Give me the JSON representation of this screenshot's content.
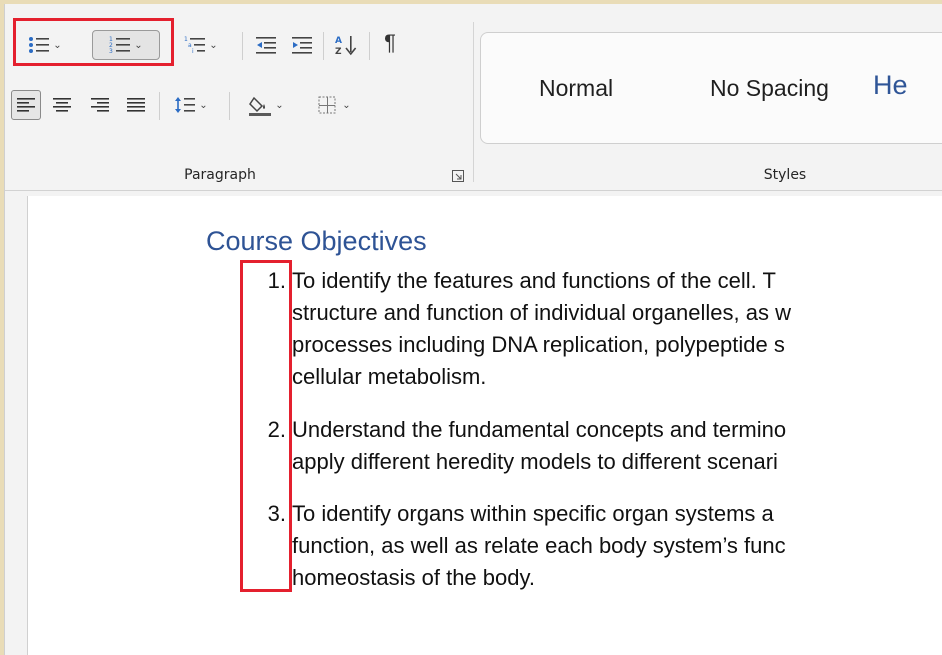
{
  "ribbon": {
    "paragraph_group": {
      "label": "Paragraph",
      "tools": {
        "bullets": "bullet-list-icon",
        "numbering": "numbered-list-icon",
        "multilevel": "multilevel-list-icon",
        "decrease_indent": "decrease-indent-icon",
        "increase_indent": "increase-indent-icon",
        "sort": "sort-icon",
        "show_marks": "¶",
        "align_left": "align-left-icon",
        "center": "align-center-icon",
        "align_right": "align-right-icon",
        "justify": "justify-icon",
        "line_spacing": "line-spacing-icon",
        "shading": "shading-icon",
        "borders": "borders-icon"
      }
    },
    "styles_group": {
      "label": "Styles",
      "items": [
        "Normal",
        "No Spacing",
        "He"
      ]
    }
  },
  "document": {
    "heading": "Course Objectives",
    "list": [
      {
        "number": "1.",
        "lines": [
          "To identify the features and functions of the cell. T",
          "structure and function of individual organelles, as w",
          "processes including DNA replication, polypeptide s",
          "cellular metabolism."
        ]
      },
      {
        "number": "2.",
        "lines": [
          "Understand the fundamental concepts and termino",
          "apply different heredity models to different scenari"
        ]
      },
      {
        "number": "3.",
        "lines": [
          "To identify organs within specific organ systems a",
          "function, as well as relate each body system’s func",
          "homeostasis of the body."
        ]
      }
    ]
  },
  "colors": {
    "highlight": "#e4202e",
    "heading": "#2e5395",
    "style_heading": "#2f5597",
    "icon_blue": "#2b6cc4"
  }
}
